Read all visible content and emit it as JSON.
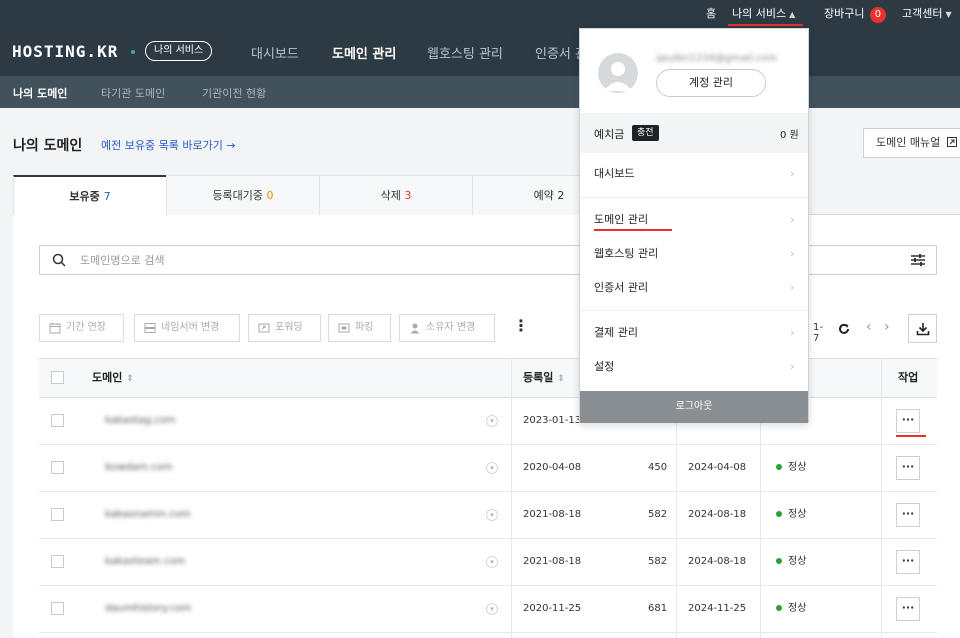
{
  "util": {
    "home": "홈",
    "my_service": "나의 서비스",
    "cart": "장바구니",
    "cart_count": "0",
    "customer_center": "고객센터"
  },
  "brand": {
    "logo": "HOSTING.KR",
    "service_pill": "나의 서비스"
  },
  "nav": {
    "dashboard": "대시보드",
    "domain": "도메인 관리",
    "webhosting": "웹호스팅 관리",
    "cert": "인증서 관"
  },
  "subnav": {
    "my_domain": "나의 도메인",
    "other_domain": "타기관 도메인",
    "transfer_status": "기관이전 현황"
  },
  "page": {
    "title": "나의 도메인",
    "backup_link": "예전 보유중 목록 바로가기 →",
    "manual_btn": "도메인 매뉴얼"
  },
  "tabs": [
    {
      "label": "보유중",
      "count": "7"
    },
    {
      "label": "등록대기중",
      "count": "0"
    },
    {
      "label": "삭제",
      "count": "3"
    },
    {
      "label": "예약",
      "count": "2"
    }
  ],
  "search": {
    "placeholder": "도메인명으로 검색"
  },
  "actions": {
    "extend": "기간 연장",
    "nameserver": "네임서버 변경",
    "forwarding": "포워딩",
    "parking": "파킹",
    "owner": "소유자 변경"
  },
  "pager": {
    "range": "1-7"
  },
  "table": {
    "headers": {
      "domain": "도메인",
      "reg_date": "등록일",
      "actions": "작업"
    },
    "rows": [
      {
        "domain": "kakaotag.com",
        "reg": "2023-01-13",
        "days": "",
        "exp": "",
        "status": ""
      },
      {
        "domain": "bowdam.com",
        "reg": "2020-04-08",
        "days": "450",
        "exp": "2024-04-08",
        "status": "정상"
      },
      {
        "domain": "kakaonamin.com",
        "reg": "2021-08-18",
        "days": "582",
        "exp": "2024-08-18",
        "status": "정상"
      },
      {
        "domain": "kakaoteam.com",
        "reg": "2021-08-18",
        "days": "582",
        "exp": "2024-08-18",
        "status": "정상"
      },
      {
        "domain": "daumhistory.com",
        "reg": "2020-11-25",
        "days": "681",
        "exp": "2024-11-25",
        "status": "정상"
      }
    ],
    "row_button": "···"
  },
  "dropdown": {
    "email": "qsuibn1234@gmail.com",
    "account_btn": "계정 관리",
    "deposit_label": "예치금",
    "charge": "충전",
    "deposit_value": "0 원",
    "items": [
      "대시보드",
      "도메인 관리",
      "웹호스팅 관리",
      "인증서 관리",
      "결제 관리",
      "설정"
    ],
    "logout": "로그아웃"
  },
  "colors": {
    "header": "#2d3a44",
    "subnav": "#42525d",
    "accent_red": "#e8322e",
    "link_blue": "#2458c6",
    "status_green": "#2e9e35"
  }
}
